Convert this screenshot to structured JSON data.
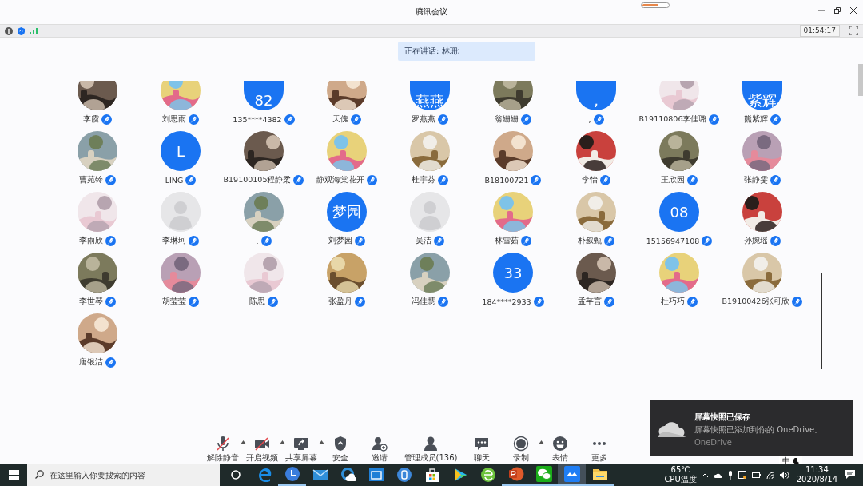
{
  "window": {
    "title": "腾讯会议"
  },
  "info_bar": {
    "timer": "01:54:17"
  },
  "speaking": {
    "text": "正在讲话: 林珊;"
  },
  "rows": [
    [
      {
        "name": "李霞"
      },
      {
        "name": "刘思雨"
      },
      {
        "name": "135****4382",
        "avatar": {
          "kind": "text",
          "text": "82"
        }
      },
      {
        "name": "天傀"
      },
      {
        "name": "罗燕燕",
        "avatar": {
          "kind": "text",
          "text": "燕燕"
        }
      },
      {
        "name": "翁姗姗"
      },
      {
        "name": ",",
        "avatar": {
          "kind": "text",
          "text": ","
        }
      },
      {
        "name": "B19110806李佳璐"
      },
      {
        "name": "熊紫辉",
        "avatar": {
          "kind": "text",
          "text": "紫辉"
        }
      }
    ],
    [
      {
        "name": "曹苑铃"
      },
      {
        "name": "LING",
        "avatar": {
          "kind": "text",
          "text": "L"
        }
      },
      {
        "name": "B19100105程静柔"
      },
      {
        "name": "静观海棠花开"
      },
      {
        "name": "杜宇芬"
      },
      {
        "name": "B18100721"
      },
      {
        "name": "李怡"
      },
      {
        "name": "王欣园"
      },
      {
        "name": "张静雯"
      }
    ],
    [
      {
        "name": "李雨欣"
      },
      {
        "name": "李琳珂",
        "avatar": {
          "kind": "default"
        }
      },
      {
        "name": "."
      },
      {
        "name": "刘梦园",
        "avatar": {
          "kind": "text",
          "text": "梦园"
        }
      },
      {
        "name": "吴洁",
        "avatar": {
          "kind": "default"
        }
      },
      {
        "name": "林雪茹"
      },
      {
        "name": "朴叙甄"
      },
      {
        "name": "15156947108",
        "avatar": {
          "kind": "text",
          "text": "08"
        }
      },
      {
        "name": "孙婉瑶"
      }
    ],
    [
      {
        "name": "李世琴"
      },
      {
        "name": "胡莹莹"
      },
      {
        "name": "陈思"
      },
      {
        "name": "张盈丹"
      },
      {
        "name": "冯佳慧"
      },
      {
        "name": "184****2933",
        "avatar": {
          "kind": "text",
          "text": "33"
        }
      },
      {
        "name": "孟芊言"
      },
      {
        "name": "杜巧巧"
      },
      {
        "name": "B19100426张可欣"
      }
    ],
    [
      {
        "name": "唐银洁"
      }
    ]
  ],
  "toolbar": [
    {
      "kind": "mic",
      "label": "解除静音",
      "has_menu": true
    },
    {
      "kind": "video",
      "label": "开启视频",
      "has_menu": true
    },
    {
      "kind": "share",
      "label": "共享屏幕",
      "has_menu": true
    },
    {
      "kind": "security",
      "label": "安全",
      "has_menu": false
    },
    {
      "kind": "invite",
      "label": "邀请",
      "has_menu": false
    },
    {
      "kind": "members",
      "label": "管理成员(136)",
      "has_menu": false
    },
    {
      "kind": "chat",
      "label": "聊天",
      "has_menu": false
    },
    {
      "kind": "record",
      "label": "录制",
      "has_menu": true
    },
    {
      "kind": "emoji",
      "label": "表情",
      "has_menu": false
    },
    {
      "kind": "more",
      "label": "更多",
      "has_menu": false
    }
  ],
  "notification": {
    "title": "屏幕快照已保存",
    "body": "屏幕快照已添加到你的 OneDrive。",
    "source": "OneDrive"
  },
  "ime_bar": {
    "text": "中"
  },
  "taskbar": {
    "search_placeholder": "在这里输入你要搜索的内容",
    "apps": [
      {
        "kind": "edge",
        "selected": false,
        "running": false
      },
      {
        "kind": "clock",
        "selected": false,
        "running": true
      },
      {
        "kind": "mail",
        "selected": false,
        "running": false
      },
      {
        "kind": "cloud",
        "selected": false,
        "running": false
      },
      {
        "kind": "window",
        "selected": false,
        "running": false
      },
      {
        "kind": "disk",
        "selected": false,
        "running": false
      },
      {
        "kind": "store",
        "selected": false,
        "running": false
      },
      {
        "kind": "video",
        "selected": false,
        "running": false
      },
      {
        "kind": "browser",
        "selected": false,
        "running": false
      },
      {
        "kind": "powerpoint",
        "selected": false,
        "running": true
      },
      {
        "kind": "wechat",
        "selected": false,
        "running": true
      },
      {
        "kind": "meeting",
        "selected": true,
        "running": true
      },
      {
        "kind": "folder",
        "selected": false,
        "running": true
      }
    ],
    "temperature": "65℃",
    "temperature_label": "CPU温度",
    "time": "11:34",
    "date": "2020/8/14"
  }
}
